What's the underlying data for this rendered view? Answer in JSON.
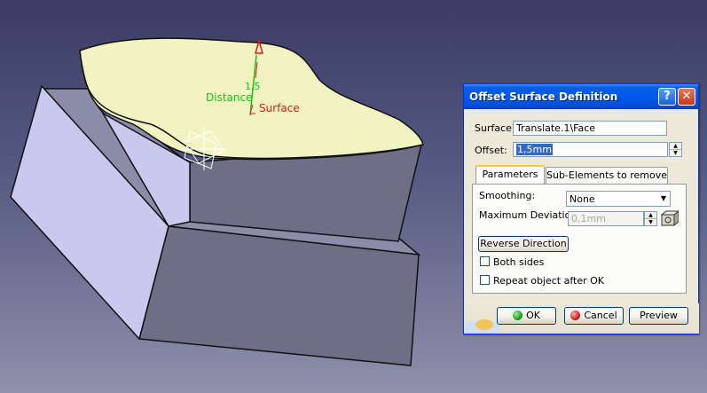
{
  "viewport": {
    "labels": {
      "distance": "Distance",
      "surface": "Surface",
      "value": "1,5"
    }
  },
  "dialog": {
    "title": "Offset Surface Definition",
    "help_glyph": "?",
    "close_glyph": "✕",
    "surface_label": "Surface:",
    "surface_value": "Translate.1\\Face",
    "offset_label": "Offset:",
    "offset_value": "1,5mm",
    "tabs": [
      {
        "label": "Parameters",
        "active": true
      },
      {
        "label": "Sub-Elements to remove",
        "active": false
      }
    ],
    "smoothing_label": "Smoothing:",
    "smoothing_value": "None",
    "max_dev_label": "Maximum Deviation:",
    "max_dev_value": "0,1mm",
    "reverse_button": "Reverse Direction",
    "both_sides_label": "Both sides",
    "both_sides_checked": false,
    "repeat_label": "Repeat object after OK",
    "repeat_checked": false,
    "ok_button": "OK",
    "cancel_button": "Cancel",
    "preview_button": "Preview"
  },
  "colors": {
    "titlebar": "#0058ee",
    "ok_icon": "#1aa51a",
    "cancel_icon": "#d42020",
    "distance_label": "#18c218",
    "surface_label": "#e01818"
  }
}
